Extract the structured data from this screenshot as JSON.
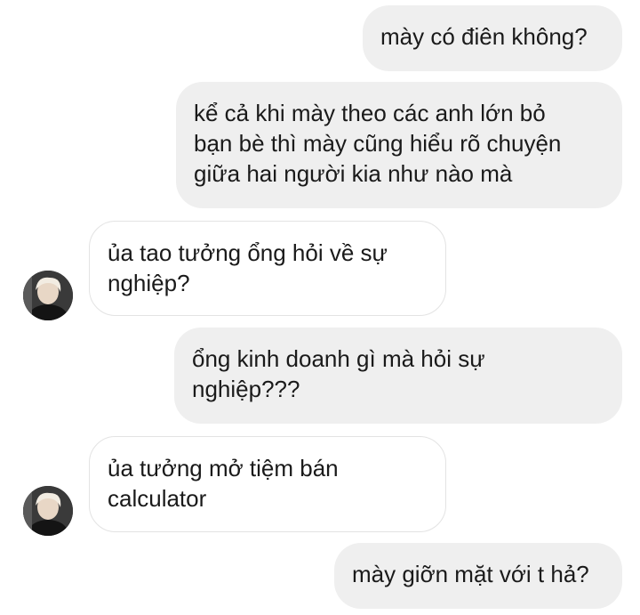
{
  "messages": [
    {
      "sender": "me",
      "text": "mày có điên không?"
    },
    {
      "sender": "me",
      "text": "kể cả khi mày theo các anh lớn bỏ\nbạn bè thì mày cũng hiểu rõ chuyện\ngiữa hai người kia như nào mà"
    },
    {
      "sender": "other",
      "text": "ủa tao tưởng ổng hỏi về sự\nnghiệp?"
    },
    {
      "sender": "me",
      "text": "ổng kinh doanh gì mà hỏi sự\nnghiệp???"
    },
    {
      "sender": "other",
      "text": "ủa tưởng mở tiệm bán\ncalculator"
    },
    {
      "sender": "me",
      "text": "mày giỡn mặt với t hả?"
    }
  ],
  "avatar": {
    "icon": "user-avatar-icon"
  },
  "colors": {
    "outgoing_bubble": "#efefef",
    "incoming_bubble": "#ffffff",
    "incoming_border": "#e3e3e3",
    "text": "#1a1a1a"
  }
}
